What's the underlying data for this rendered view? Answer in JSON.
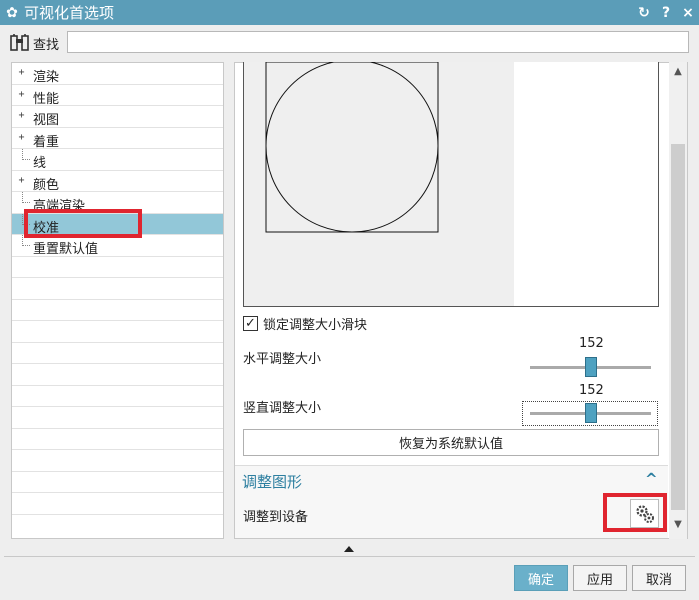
{
  "window": {
    "title": "可视化首选项",
    "controls": {
      "reset": "↻",
      "help": "?",
      "close": "×"
    }
  },
  "find": {
    "label": "查找",
    "value": ""
  },
  "tree": {
    "items": [
      {
        "label": "渲染",
        "expandable": true
      },
      {
        "label": "性能",
        "expandable": true
      },
      {
        "label": "视图",
        "expandable": true
      },
      {
        "label": "着重",
        "expandable": true
      },
      {
        "label": "线",
        "expandable": false
      },
      {
        "label": "颜色",
        "expandable": true
      },
      {
        "label": "高端渲染",
        "expandable": false
      },
      {
        "label": "校准",
        "expandable": false,
        "selected": true
      },
      {
        "label": "重置默认值",
        "expandable": false
      }
    ],
    "expand_glyph": "+"
  },
  "calibration": {
    "lock_label": "锁定调整大小滑块",
    "lock_checked": true,
    "lock_mark": "✓",
    "horizontal": {
      "label": "水平调整大小",
      "value": "152",
      "fraction": 0.5
    },
    "vertical": {
      "label": "竖直调整大小",
      "value": "152",
      "fraction": 0.5
    },
    "reset_label": "恢复为系统默认值"
  },
  "section": {
    "title": "调整图形",
    "collapse_glyph": "^",
    "device_label": "调整到设备"
  },
  "footer": {
    "ok": "确定",
    "apply": "应用",
    "cancel": "取消"
  },
  "colors": {
    "titlebar": "#5b9db8",
    "selection": "#92c7d8",
    "accent": "#2d7fa0",
    "highlight": "#e0252f"
  }
}
